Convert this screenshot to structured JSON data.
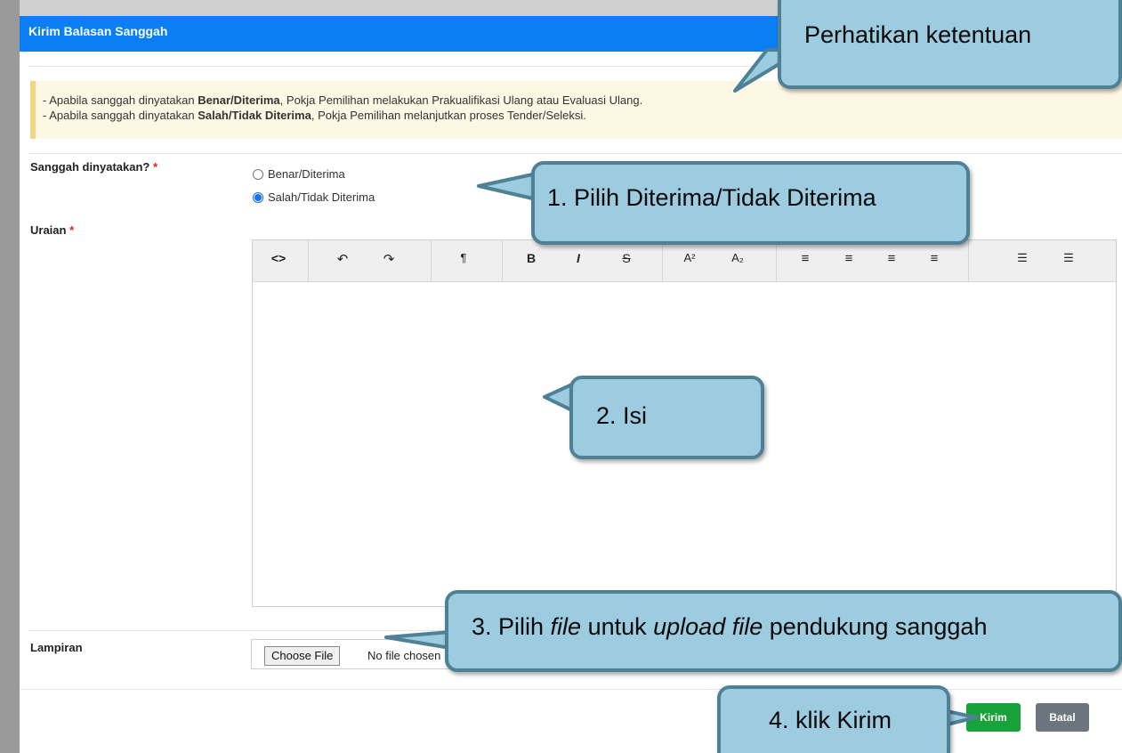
{
  "modal": {
    "title": "Kirim Balasan Sanggah"
  },
  "notice": {
    "line1_prefix": "- Apabila sanggah dinyatakan ",
    "line1_bold": "Benar/Diterima",
    "line1_suffix": ", Pokja Pemilihan melakukan Prakualifikasi Ulang atau Evaluasi Ulang.",
    "line2_prefix": "- Apabila sanggah dinyatakan ",
    "line2_bold": "Salah/Tidak Diterima",
    "line2_suffix": ", Pokja Pemilihan melanjutkan proses Tender/Seleksi."
  },
  "form": {
    "sanggah_label": "Sanggah dinyatakan?",
    "required_mark": "*",
    "options": [
      {
        "label": "Benar/Diterima",
        "checked": false
      },
      {
        "label": "Salah/Tidak Diterima",
        "checked": true
      }
    ],
    "uraian_label": "Uraian",
    "lampiran_label": "Lampiran",
    "choose_file": "Choose File",
    "no_file": "No file chosen"
  },
  "toolbar": {
    "buttons": [
      {
        "icon": "code-view-icon",
        "glyph": "<>"
      },
      {
        "icon": "undo-icon",
        "glyph": "↶"
      },
      {
        "icon": "redo-icon",
        "glyph": "↷"
      },
      {
        "icon": "paragraph-icon",
        "glyph": "¶"
      },
      {
        "icon": "bold-icon",
        "glyph": "B"
      },
      {
        "icon": "italic-icon",
        "glyph": "I"
      },
      {
        "icon": "strikethrough-icon",
        "glyph": "S"
      },
      {
        "icon": "superscript-icon",
        "glyph": "A²"
      },
      {
        "icon": "subscript-icon",
        "glyph": "A₂"
      },
      {
        "icon": "align-left-icon",
        "glyph": "≡"
      },
      {
        "icon": "align-center-icon",
        "glyph": "≡"
      },
      {
        "icon": "align-right-icon",
        "glyph": "≡"
      },
      {
        "icon": "align-justify-icon",
        "glyph": "≡"
      },
      {
        "icon": "unordered-list-icon",
        "glyph": "☰"
      },
      {
        "icon": "ordered-list-icon",
        "glyph": "☰"
      }
    ]
  },
  "footer": {
    "kirim": "Kirim",
    "batal": "Batal"
  },
  "callouts": {
    "perhatikan": "Perhatikan ketentuan",
    "step1": "1.  Pilih Diterima/Tidak Diterima",
    "step2": "2. Isi",
    "step3_parts": [
      "3.  Pilih ",
      "file",
      " untuk ",
      "upload file",
      " pendukung sanggah"
    ],
    "step4": "4. klik Kirim"
  },
  "colors": {
    "header": "#0a7ef2",
    "callout_fill": "#9dcbdf",
    "callout_border": "#4e8196",
    "kirim": "#19a23a",
    "batal": "#6c757d"
  }
}
